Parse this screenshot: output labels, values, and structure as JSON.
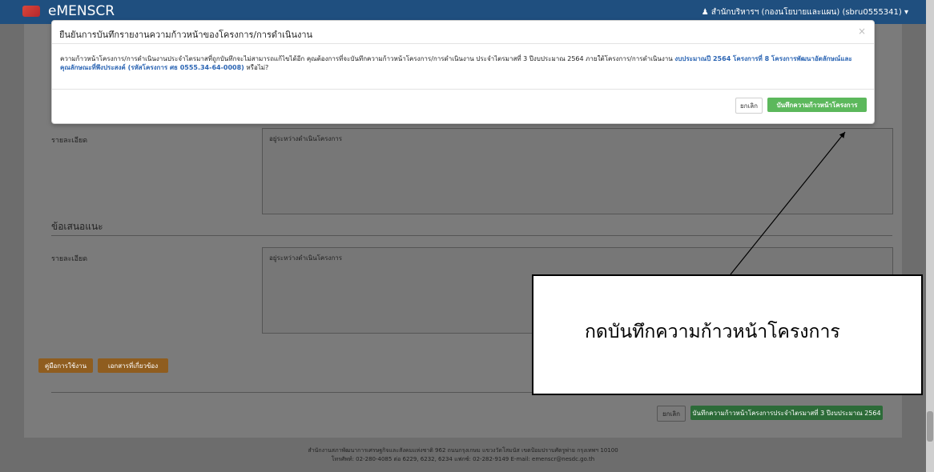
{
  "topbar": {
    "brand": "eMENSCR",
    "user": "♟ สำนักบริหารฯ (กองนโยบายและแผน) (sbru0555341) ▾"
  },
  "sections": [
    {
      "title": "",
      "label": "รายละเอียด",
      "placeholder": "อยู่ระหว่างดำเนินโครงการ"
    },
    {
      "title": "ข้อเสนอแนะ",
      "label": "รายละเอียด",
      "placeholder": "อยู่ระหว่างดำเนินโครงการ"
    }
  ],
  "actions": {
    "manual_label": "คู่มือการใช้งาน",
    "sample_label": "เอกสารที่เกี่ยวข้อง",
    "cancel_label": "ยกเลิก",
    "save_label": "บันทึกความก้าวหน้าโครงการประจำไตรมาสที่ 3 ปีงบประมาณ 2564"
  },
  "footer": {
    "line1": "สำนักงานสภาพัฒนาการเศรษฐกิจและสังคมแห่งชาติ 962 ถนนกรุงเกษม แขวงวัดโสมนัส เขตป้อมปราบศัตรูพ่าย กรุงเทพฯ 10100",
    "line2": "โทรศัพท์: 02-280-4085 ต่อ 6229, 6232, 6234 แฟกซ์: 02-282-9149 E-mail: emenscr@nesdc.go.th"
  },
  "modal": {
    "title": "ยืนยันการบันทึกรายงานความก้าวหน้าของโครงการ/การดำเนินงาน",
    "close": "×",
    "body_text": "ความก้าวหน้าโครงการ/การดำเนินงานประจำไตรมาสที่ถูกบันทึกจะไม่สามารถแก้ไขได้อีก คุณต้องการที่จะบันทึกความก้าวหน้าโครงการ/การดำเนินงาน ประจำไตรมาสที่ 3 ปีงบประมาณ 2564 ภายใต้โครงการ/การดำเนินงาน ",
    "body_highlight": "งบประมาณปี 2564 โครงการที่ 8 โครงการพัฒนาอัตลักษณ์และคุณลักษณะที่พึงประสงค์ (รหัสโครงการ ศธ 0555.34-64-0008)",
    "body_suffix": " หรือไม่?",
    "cancel_label": "ยกเลิก",
    "save_label": "บันทึกความก้าวหน้าโครงการ"
  },
  "callout": {
    "text": "กดบันทึกความก้าวหน้าโครงการ"
  }
}
